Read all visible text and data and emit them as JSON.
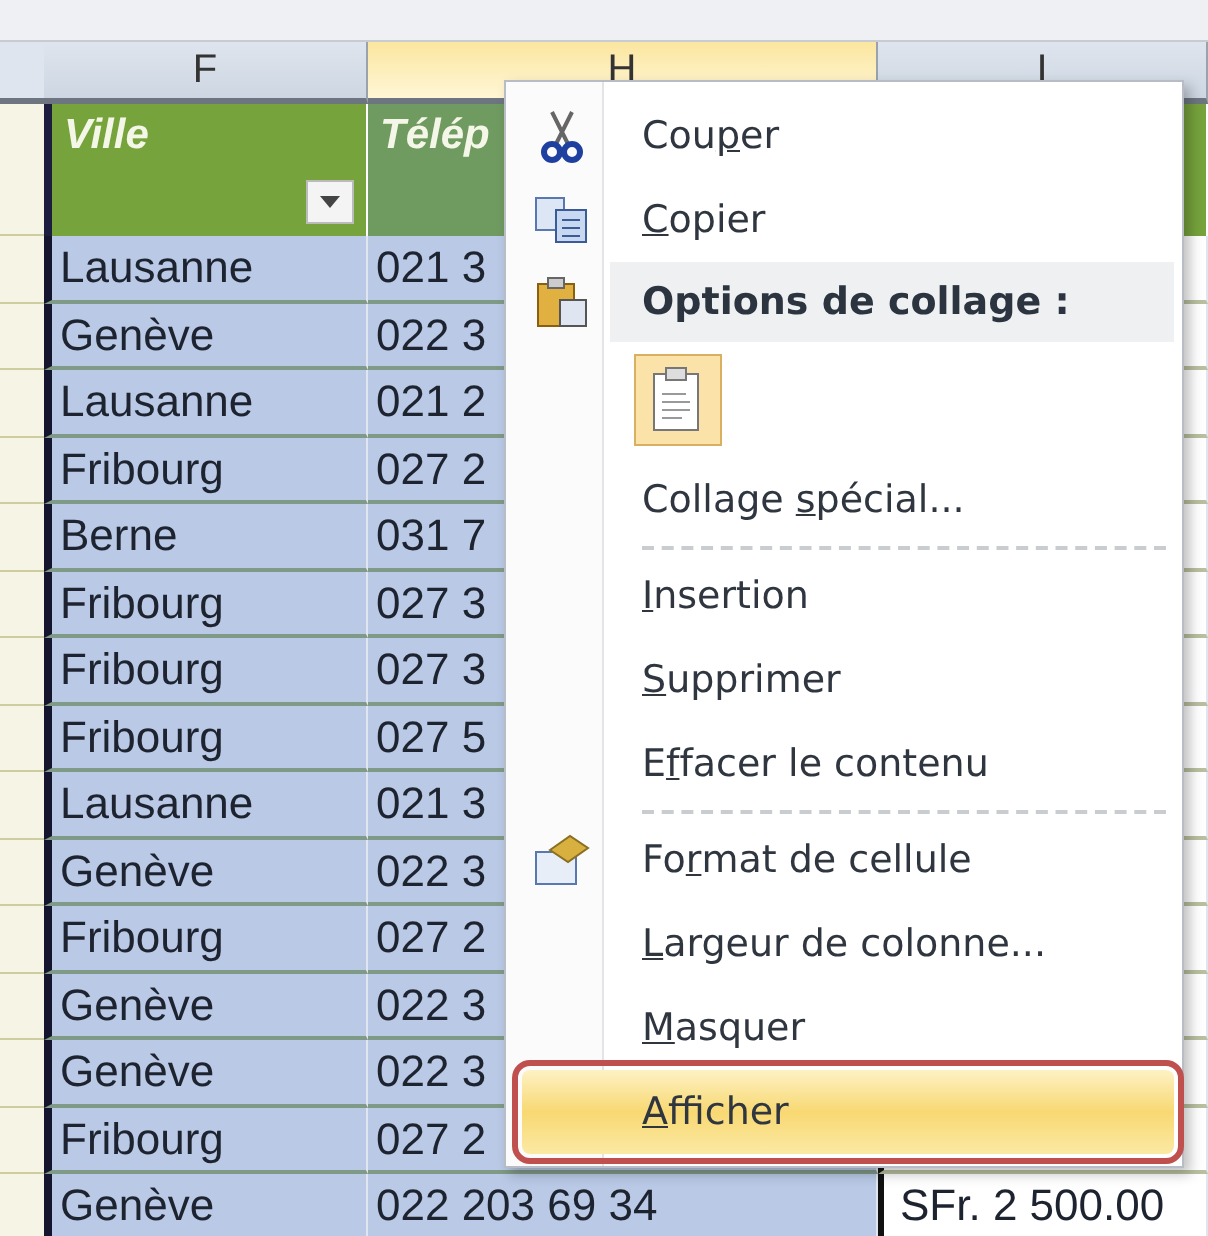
{
  "column_headers": [
    {
      "label": "F",
      "selected": false
    },
    {
      "label": "H",
      "selected": true
    },
    {
      "label": "I",
      "selected": false
    }
  ],
  "table": {
    "columns": [
      {
        "label": "Ville",
        "filter": true
      },
      {
        "label": "Télép"
      }
    ],
    "rows": [
      {
        "city": "Lausanne",
        "phone": "021 3"
      },
      {
        "city": "Genève",
        "phone": "022 3"
      },
      {
        "city": "Lausanne",
        "phone": "021 2"
      },
      {
        "city": "Fribourg",
        "phone": "027 2"
      },
      {
        "city": "Berne",
        "phone": "031 7"
      },
      {
        "city": "Fribourg",
        "phone": "027 3"
      },
      {
        "city": "Fribourg",
        "phone": "027 3"
      },
      {
        "city": "Fribourg",
        "phone": "027 5"
      },
      {
        "city": "Lausanne",
        "phone": "021 3"
      },
      {
        "city": "Genève",
        "phone": "022 3"
      },
      {
        "city": "Fribourg",
        "phone": "027 2"
      },
      {
        "city": "Genève",
        "phone": "022 3"
      },
      {
        "city": "Genève",
        "phone": "022 3"
      },
      {
        "city": "Fribourg",
        "phone": "027 2"
      },
      {
        "city": "Genève",
        "phone": "022 203 69 34",
        "column_3": "SFr. 2 500.00"
      }
    ]
  },
  "context_menu": {
    "items": [
      {
        "kind": "item",
        "before": "Cou",
        "mnemonic": "p",
        "after": "er",
        "selected": false
      },
      {
        "kind": "item",
        "mnemonic": "C",
        "after": "opier",
        "selected": false
      },
      {
        "kind": "header",
        "label": "Options de collage :"
      },
      {
        "kind": "paste-option"
      },
      {
        "kind": "item",
        "before": "Collage ",
        "mnemonic": "s",
        "after": "pécial...",
        "selected": false
      },
      {
        "kind": "separator"
      },
      {
        "kind": "item",
        "mnemonic": "I",
        "after": "nsertion",
        "selected": false
      },
      {
        "kind": "item",
        "mnemonic": "S",
        "after": "upprimer",
        "selected": false
      },
      {
        "kind": "item",
        "before": "E",
        "mnemonic": "f",
        "after": "facer le contenu",
        "selected": false
      },
      {
        "kind": "separator"
      },
      {
        "kind": "item",
        "before": "Fo",
        "mnemonic": "r",
        "after": "mat de cellule",
        "selected": false
      },
      {
        "kind": "item",
        "mnemonic": "L",
        "after": "argeur de colonne...",
        "selected": false
      },
      {
        "kind": "item",
        "mnemonic": "M",
        "after": "asquer",
        "selected": false
      },
      {
        "kind": "item",
        "mnemonic": "A",
        "after": "fficher",
        "selected": true
      }
    ]
  }
}
